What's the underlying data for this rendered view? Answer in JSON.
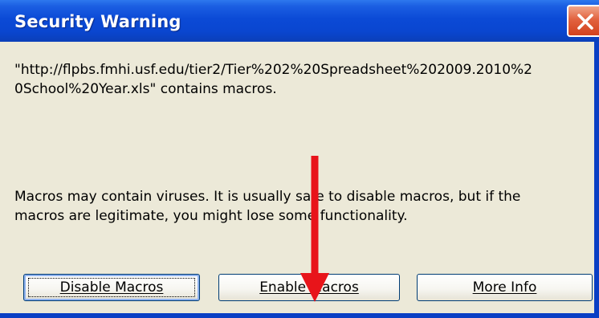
{
  "dialog": {
    "title": "Security Warning",
    "message_lines": [
      "\"http://flpbs.fmhi.usf.edu/tier2/Tier%202%20Spreadsheet%202009.2010%2",
      "0School%20Year.xls\" contains macros."
    ],
    "warning_lines": [
      "Macros may contain viruses. It is usually safe to disable macros, but if the",
      "macros are legitimate, you might lose some functionality."
    ]
  },
  "buttons": {
    "disable": "Disable Macros",
    "enable": "Enable Macros",
    "more_info": "More Info"
  },
  "icons": {
    "close": "close-icon",
    "annotation": "red-arrow-icon"
  },
  "colors": {
    "title_bar": "#0b4ad6",
    "close_button": "#e2623f",
    "dialog_background": "#ece9d8",
    "annotation_arrow": "#e8141a"
  }
}
